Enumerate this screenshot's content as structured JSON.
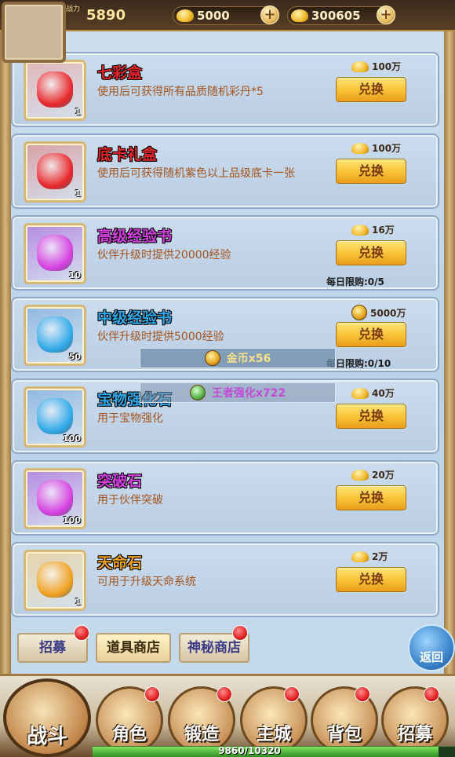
{
  "header": {
    "power_label": "战力",
    "power_value": "5890",
    "gold_ingots": "5000",
    "coins": "300605",
    "plus_label": "+"
  },
  "items": [
    {
      "name": "七彩盒",
      "name_color": "#e8262a",
      "desc": "使用后可获得所有品质随机彩丹*5",
      "count": "1",
      "price": "100万",
      "currency": "ingot",
      "button": "兑换",
      "limit": "",
      "icon": "colorful-pouch-icon",
      "frame": "#e0b5b8"
    },
    {
      "name": "底卡礼盒",
      "name_color": "#e8262a",
      "desc": "使用后可获得随机紫色以上品级底卡一张",
      "count": "1",
      "price": "100万",
      "currency": "ingot",
      "button": "兑换",
      "limit": "",
      "icon": "gift-pouch-icon",
      "frame": "#d8a0a5"
    },
    {
      "name": "高级经验书",
      "name_color": "#d53fe0",
      "desc": "伙伴升级时提供20000经验",
      "count": "10",
      "price": "16万",
      "currency": "ingot",
      "button": "兑换",
      "limit": "每日限购:0/5",
      "icon": "gold-book-icon",
      "frame": "#b48ae0"
    },
    {
      "name": "中级经验书",
      "name_color": "#2ea8e8",
      "desc": "伙伴升级时提供5000经验",
      "count": "50",
      "price": "5000万",
      "currency": "coin",
      "button": "兑换",
      "limit": "每日限购:0/10",
      "icon": "blue-book-icon",
      "frame": "#8fb7e0"
    },
    {
      "name": "宝物强化石",
      "name_color": "#2ea8e8",
      "desc": "用于宝物强化",
      "count": "100",
      "price": "40万",
      "currency": "ingot",
      "button": "兑换",
      "limit": "",
      "icon": "green-gem-icon",
      "frame": "#8fb7e0"
    },
    {
      "name": "突破石",
      "name_color": "#d53fe0",
      "desc": "用于伙伴突破",
      "count": "100",
      "price": "20万",
      "currency": "ingot",
      "button": "兑换",
      "limit": "",
      "icon": "blue-crystal-icon",
      "frame": "#b48ae0"
    },
    {
      "name": "天命石",
      "name_color": "#f0a020",
      "desc": "可用于升级天命系统",
      "count": "1",
      "price": "2万",
      "currency": "ingot",
      "button": "兑换",
      "limit": "",
      "icon": "jade-stone-icon",
      "frame": "#e7d3a8"
    }
  ],
  "toasts": [
    {
      "text": "金币x56"
    },
    {
      "text": "王者强化x722"
    }
  ],
  "sub_tabs": [
    {
      "label": "招募"
    },
    {
      "label": "道具商店"
    },
    {
      "label": "神秘商店"
    }
  ],
  "back_label": "返回",
  "nav": [
    {
      "label": "战斗"
    },
    {
      "label": "角色"
    },
    {
      "label": "锻造"
    },
    {
      "label": "主城"
    },
    {
      "label": "背包"
    },
    {
      "label": "招募"
    }
  ],
  "exp": {
    "text": "9860/10320",
    "fraction": 0.955
  }
}
